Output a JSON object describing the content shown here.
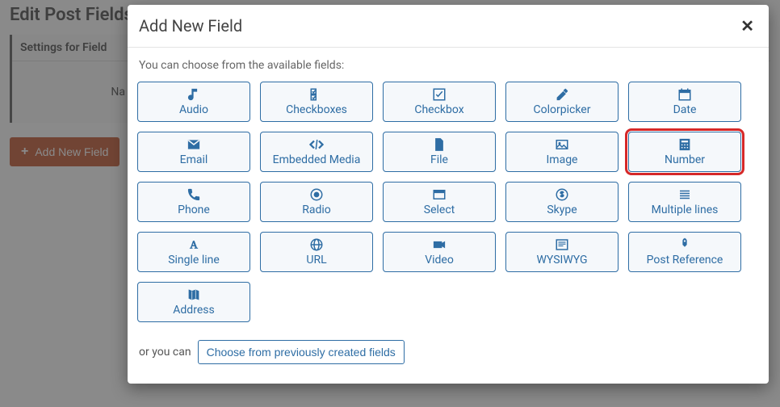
{
  "page": {
    "title": "Edit Post Fields",
    "settings_header": "Settings for Field",
    "name_label": "Na",
    "add_button": "Add New Field"
  },
  "modal": {
    "title": "Add New Field",
    "intro": "You can choose from the available fields:",
    "prev_prefix": "or you can",
    "prev_button": "Choose from previously created fields",
    "highlighted": "Number",
    "fields": [
      {
        "id": "audio",
        "label": "Audio",
        "icon": "audio"
      },
      {
        "id": "checkboxes",
        "label": "Checkboxes",
        "icon": "checkboxes"
      },
      {
        "id": "checkbox",
        "label": "Checkbox",
        "icon": "checkbox"
      },
      {
        "id": "colorpicker",
        "label": "Colorpicker",
        "icon": "colorpicker"
      },
      {
        "id": "date",
        "label": "Date",
        "icon": "date"
      },
      {
        "id": "email",
        "label": "Email",
        "icon": "email"
      },
      {
        "id": "embedded-media",
        "label": "Embedded Media",
        "icon": "embedded-media"
      },
      {
        "id": "file",
        "label": "File",
        "icon": "file"
      },
      {
        "id": "image",
        "label": "Image",
        "icon": "image"
      },
      {
        "id": "number",
        "label": "Number",
        "icon": "number"
      },
      {
        "id": "phone",
        "label": "Phone",
        "icon": "phone"
      },
      {
        "id": "radio",
        "label": "Radio",
        "icon": "radio"
      },
      {
        "id": "select",
        "label": "Select",
        "icon": "select"
      },
      {
        "id": "skype",
        "label": "Skype",
        "icon": "skype"
      },
      {
        "id": "multiple-lines",
        "label": "Multiple lines",
        "icon": "multiple-lines"
      },
      {
        "id": "single-line",
        "label": "Single line",
        "icon": "single-line"
      },
      {
        "id": "url",
        "label": "URL",
        "icon": "url"
      },
      {
        "id": "video",
        "label": "Video",
        "icon": "video"
      },
      {
        "id": "wysiwyg",
        "label": "WYSIWYG",
        "icon": "wysiwyg"
      },
      {
        "id": "post-reference",
        "label": "Post Reference",
        "icon": "post-reference"
      },
      {
        "id": "address",
        "label": "Address",
        "icon": "address"
      }
    ]
  },
  "colors": {
    "accent": "#2e6da4",
    "danger": "#c0512a",
    "highlight": "#d62828"
  }
}
